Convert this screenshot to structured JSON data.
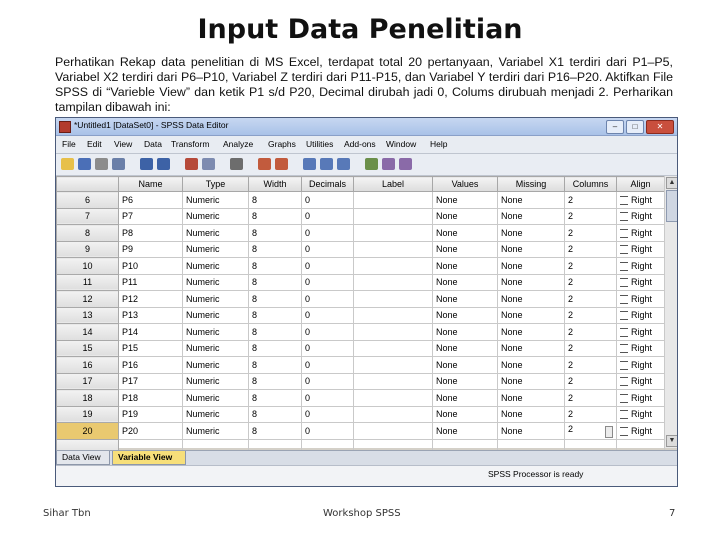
{
  "slide": {
    "title": "Input Data Penelitian",
    "intro": "Perhatikan Rekap data penelitian di MS Excel, terdapat total 20 pertanyaan, Variabel X1 terdiri dari P1–P5, Variabel X2 terdiri dari P6–P10, Variabel Z terdiri dari P11-P15, dan Variabel Y terdiri dari P16–P20. Aktifkan File SPSS di “Varieble View” dan ketik P1 s/d P20, Decimal dirubah jadi 0, Colums dirubuah menjadi 2. Perharikan tampilan dibawah ini:",
    "footer_left": "Sihar Tbn",
    "footer_center": "Workshop SPSS",
    "page_number": "7"
  },
  "window": {
    "title": "*Untitled1 [DataSet0] - SPSS Data Editor",
    "min_label": "–",
    "max_label": "□",
    "close_label": "✕"
  },
  "menu": [
    "File",
    "Edit",
    "View",
    "Data",
    "Transform",
    "Analyze",
    "Graphs",
    "Utilities",
    "Add-ons",
    "Window",
    "Help"
  ],
  "toolbar_icons": [
    "open-icon",
    "save-icon",
    "print-icon",
    "dialog-recall-icon",
    "undo-icon",
    "redo-icon",
    "goto-case-icon",
    "variables-icon",
    "find-icon",
    "insert-cases-icon",
    "insert-variable-icon",
    "split-file-icon",
    "weight-cases-icon",
    "select-cases-icon",
    "value-labels-icon",
    "use-sets-icon",
    "show-all-icon"
  ],
  "grid": {
    "columns": [
      "Name",
      "Type",
      "Width",
      "Decimals",
      "Label",
      "Values",
      "Missing",
      "Columns",
      "Align"
    ],
    "rows": [
      {
        "n": "6",
        "name": "P6",
        "type": "Numeric",
        "width": "8",
        "decimals": "0",
        "label": "",
        "values": "None",
        "missing": "None",
        "columns": "2",
        "align": "Right"
      },
      {
        "n": "7",
        "name": "P7",
        "type": "Numeric",
        "width": "8",
        "decimals": "0",
        "label": "",
        "values": "None",
        "missing": "None",
        "columns": "2",
        "align": "Right"
      },
      {
        "n": "8",
        "name": "P8",
        "type": "Numeric",
        "width": "8",
        "decimals": "0",
        "label": "",
        "values": "None",
        "missing": "None",
        "columns": "2",
        "align": "Right"
      },
      {
        "n": "9",
        "name": "P9",
        "type": "Numeric",
        "width": "8",
        "decimals": "0",
        "label": "",
        "values": "None",
        "missing": "None",
        "columns": "2",
        "align": "Right"
      },
      {
        "n": "10",
        "name": "P10",
        "type": "Numeric",
        "width": "8",
        "decimals": "0",
        "label": "",
        "values": "None",
        "missing": "None",
        "columns": "2",
        "align": "Right"
      },
      {
        "n": "11",
        "name": "P11",
        "type": "Numeric",
        "width": "8",
        "decimals": "0",
        "label": "",
        "values": "None",
        "missing": "None",
        "columns": "2",
        "align": "Right"
      },
      {
        "n": "12",
        "name": "P12",
        "type": "Numeric",
        "width": "8",
        "decimals": "0",
        "label": "",
        "values": "None",
        "missing": "None",
        "columns": "2",
        "align": "Right"
      },
      {
        "n": "13",
        "name": "P13",
        "type": "Numeric",
        "width": "8",
        "decimals": "0",
        "label": "",
        "values": "None",
        "missing": "None",
        "columns": "2",
        "align": "Right"
      },
      {
        "n": "14",
        "name": "P14",
        "type": "Numeric",
        "width": "8",
        "decimals": "0",
        "label": "",
        "values": "None",
        "missing": "None",
        "columns": "2",
        "align": "Right"
      },
      {
        "n": "15",
        "name": "P15",
        "type": "Numeric",
        "width": "8",
        "decimals": "0",
        "label": "",
        "values": "None",
        "missing": "None",
        "columns": "2",
        "align": "Right"
      },
      {
        "n": "16",
        "name": "P16",
        "type": "Numeric",
        "width": "8",
        "decimals": "0",
        "label": "",
        "values": "None",
        "missing": "None",
        "columns": "2",
        "align": "Right"
      },
      {
        "n": "17",
        "name": "P17",
        "type": "Numeric",
        "width": "8",
        "decimals": "0",
        "label": "",
        "values": "None",
        "missing": "None",
        "columns": "2",
        "align": "Right"
      },
      {
        "n": "18",
        "name": "P18",
        "type": "Numeric",
        "width": "8",
        "decimals": "0",
        "label": "",
        "values": "None",
        "missing": "None",
        "columns": "2",
        "align": "Right"
      },
      {
        "n": "19",
        "name": "P19",
        "type": "Numeric",
        "width": "8",
        "decimals": "0",
        "label": "",
        "values": "None",
        "missing": "None",
        "columns": "2",
        "align": "Right"
      },
      {
        "n": "20",
        "name": "P20",
        "type": "Numeric",
        "width": "8",
        "decimals": "0",
        "label": "",
        "values": "None",
        "missing": "None",
        "columns": "2",
        "align": "Right"
      },
      {
        "n": "",
        "name": "",
        "type": "",
        "width": "",
        "decimals": "",
        "label": "",
        "values": "",
        "missing": "",
        "columns": "",
        "align": ""
      }
    ],
    "active_row": "20"
  },
  "tabs": {
    "data_view": "Data View",
    "variable_view": "Variable View"
  },
  "status": "SPSS Processor is ready",
  "colors": {
    "active_tab": "#f7df7a",
    "active_row_header": "#e9c970",
    "close_button": "#c94f3d"
  }
}
